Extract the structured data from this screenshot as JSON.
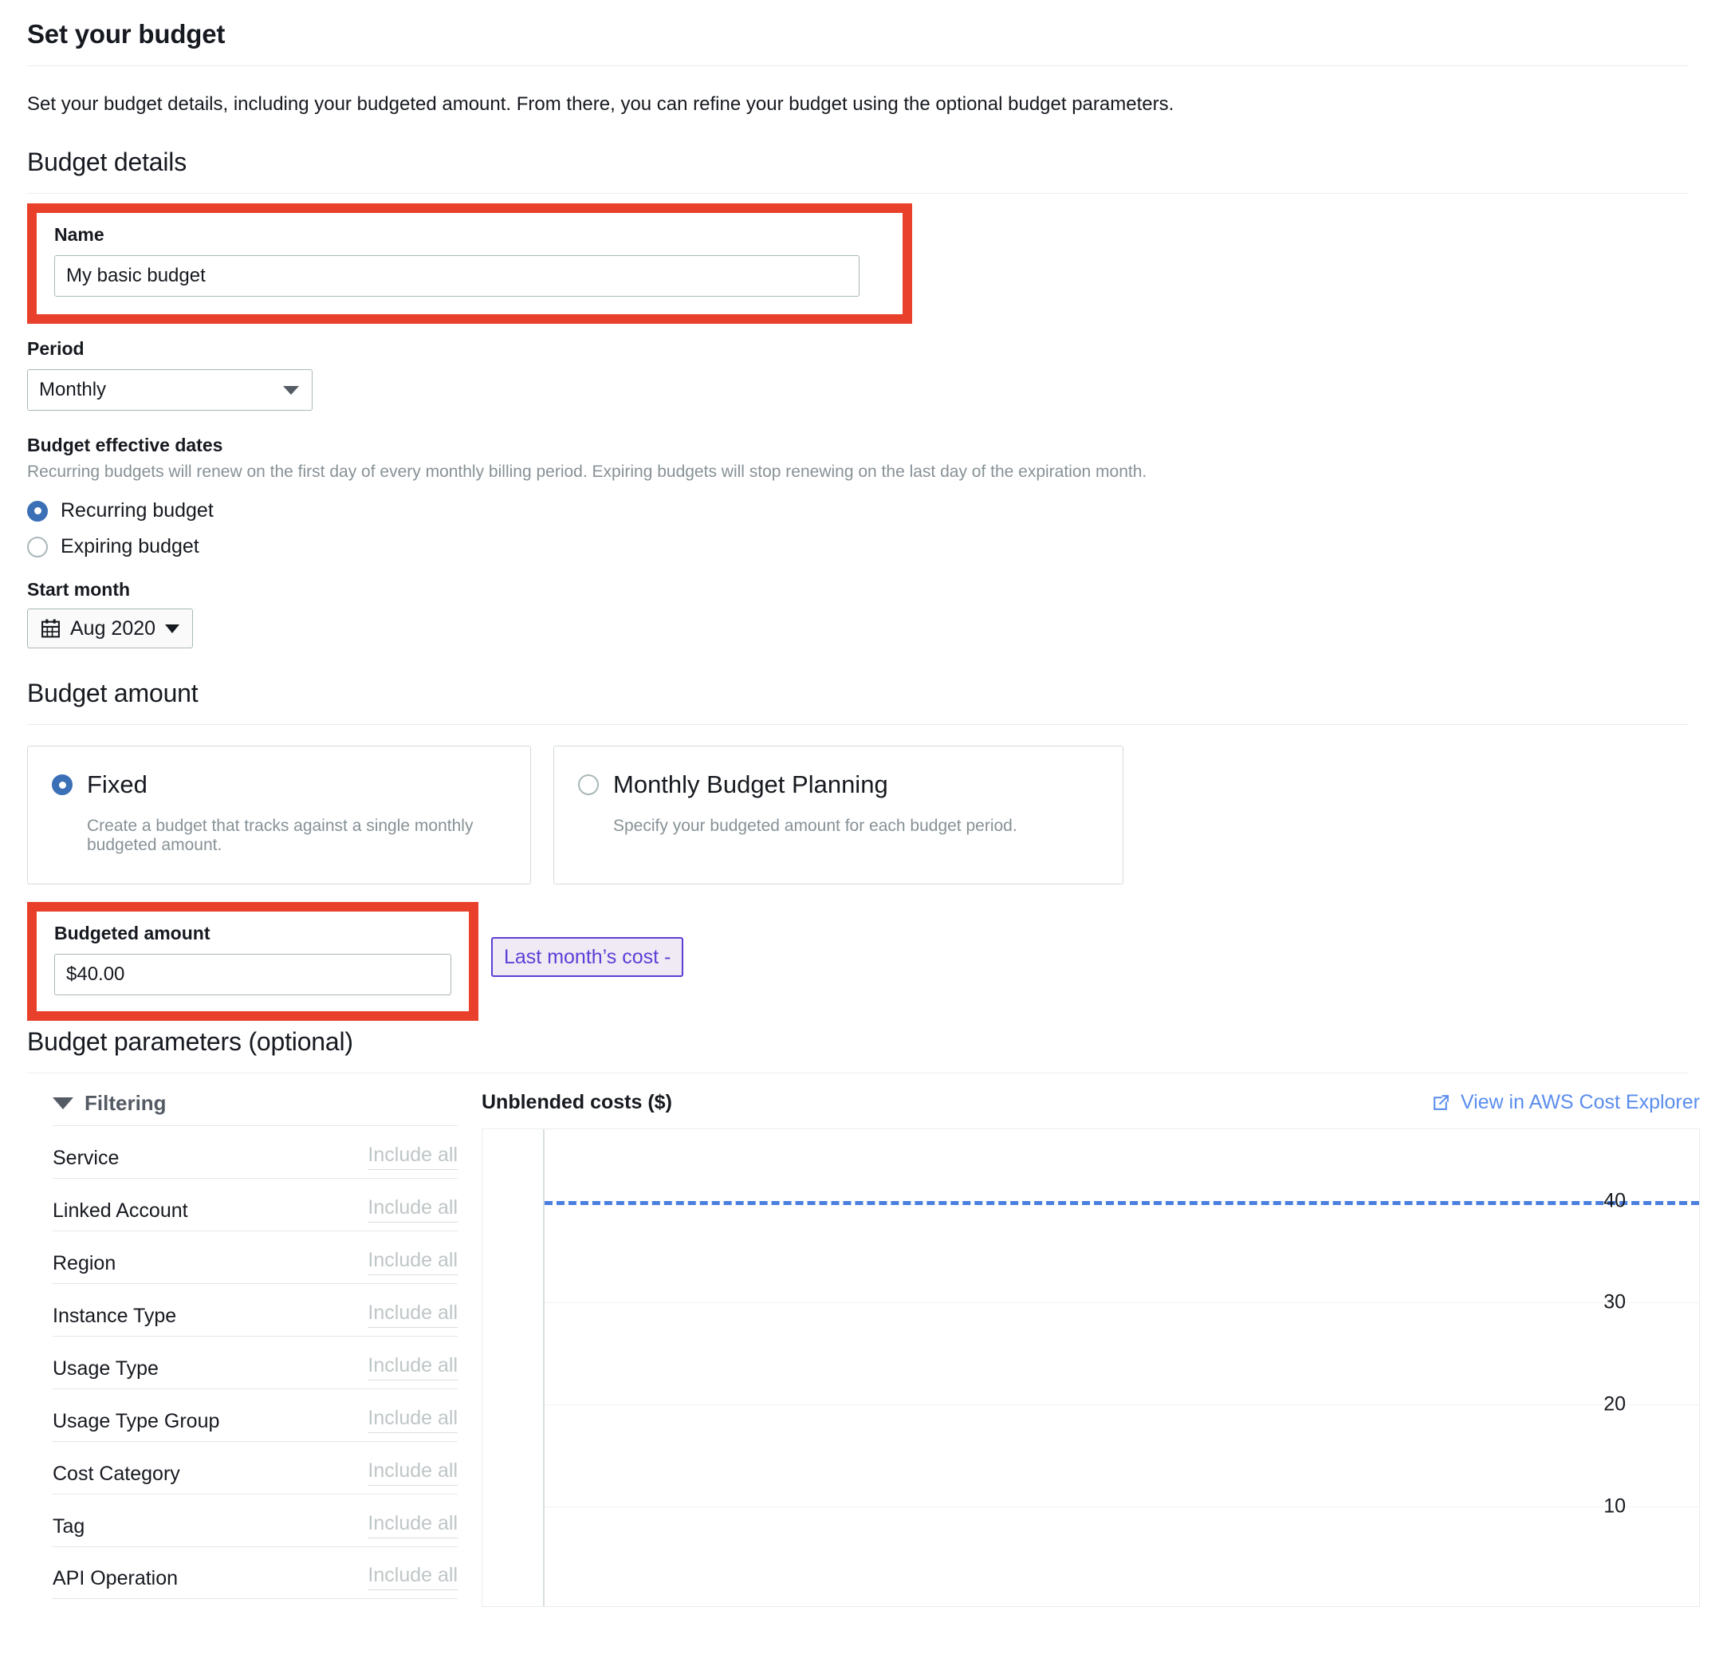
{
  "header": {
    "title": "Set your budget",
    "description": "Set your budget details, including your budgeted amount. From there, you can refine your budget using the optional budget parameters."
  },
  "budget_details": {
    "heading": "Budget details",
    "name_label": "Name",
    "name_value": "My basic budget",
    "period_label": "Period",
    "period_value": "Monthly",
    "effective_dates_label": "Budget effective dates",
    "effective_dates_hint": "Recurring budgets will renew on the first day of every monthly billing period. Expiring budgets will stop renewing on the last day of the expiration month.",
    "recurring_label": "Recurring budget",
    "expiring_label": "Expiring budget",
    "start_month_label": "Start month",
    "start_month_value": "Aug 2020",
    "calendar_icon": "calendar-icon",
    "caret_icon": "chevron-down-icon"
  },
  "budget_amount": {
    "heading": "Budget amount",
    "fixed_title": "Fixed",
    "fixed_desc": "Create a budget that tracks against a single monthly budgeted amount.",
    "planning_title": "Monthly Budget Planning",
    "planning_desc": "Specify your budgeted amount for each budget period.",
    "budgeted_amount_label": "Budgeted amount",
    "budgeted_amount_value": "$40.00",
    "last_month_cost_label": "Last month’s cost -"
  },
  "budget_parameters": {
    "heading": "Budget parameters (optional)",
    "filtering_title": "Filtering",
    "filter_toggle_icon": "triangle-down-icon",
    "filters": [
      {
        "name": "Service",
        "value": "Include all"
      },
      {
        "name": "Linked Account",
        "value": "Include all"
      },
      {
        "name": "Region",
        "value": "Include all"
      },
      {
        "name": "Instance Type",
        "value": "Include all"
      },
      {
        "name": "Usage Type",
        "value": "Include all"
      },
      {
        "name": "Usage Type Group",
        "value": "Include all"
      },
      {
        "name": "Cost Category",
        "value": "Include all"
      },
      {
        "name": "Tag",
        "value": "Include all"
      },
      {
        "name": "API Operation",
        "value": "Include all"
      }
    ]
  },
  "chart_panel": {
    "title": "Unblended costs ($)",
    "cost_explorer_link": "View in AWS Cost Explorer",
    "external_link_icon": "external-link-icon"
  },
  "chart_data": {
    "type": "line",
    "title": "Unblended costs ($)",
    "xlabel": "",
    "ylabel": "Unblended costs ($)",
    "ylim": [
      0,
      47
    ],
    "yticks": [
      40,
      30,
      20,
      10
    ],
    "grid": true,
    "legend_position": "none",
    "series": [
      {
        "name": "Budgeted amount",
        "style": "dashed-horizontal",
        "color": "#4a7fe0",
        "value": 40
      }
    ],
    "annotations": [
      "Dashed blue budget threshold line drawn at y = 40"
    ],
    "note": "No cost bars rendered; plot area is empty apart from the budget threshold line."
  },
  "colors": {
    "annotation_red": "#e8402a",
    "aws_blue": "#3b6fb6",
    "link_blue": "#5a8ded",
    "budget_line_blue": "#4a7fe0",
    "button_purple": "#5b3fd8",
    "button_purple_bg": "#efeaf3",
    "muted_text": "#879196"
  }
}
